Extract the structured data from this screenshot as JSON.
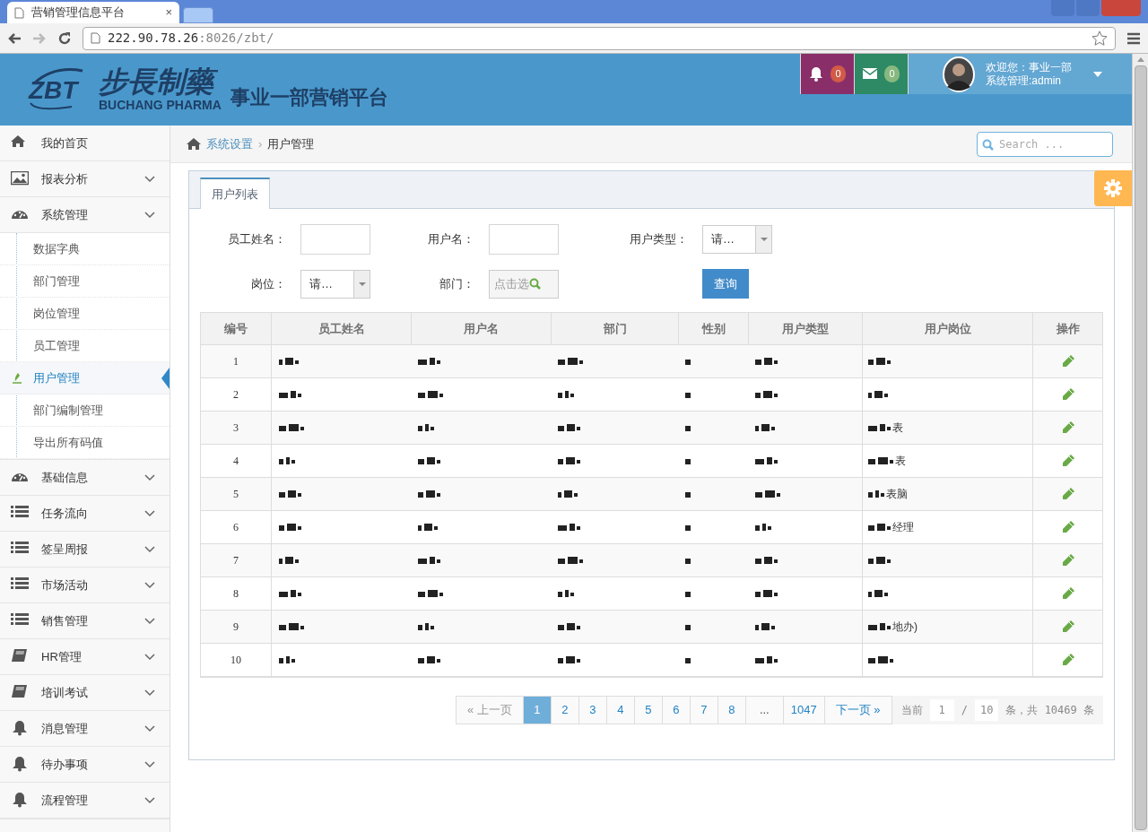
{
  "browser": {
    "tab_title": "营销管理信息平台",
    "tab_close": "×",
    "url_host": "222.90.78.26",
    "url_rest": ":8026/zbt/"
  },
  "header": {
    "logo_text": "ZBT",
    "brand_cn": "步長制藥",
    "brand_en": "BUCHANG PHARMA",
    "platform_title": "事业一部营销平台",
    "notifications": [
      {
        "kind": "bell",
        "count": "0"
      },
      {
        "kind": "mail",
        "count": "0"
      }
    ],
    "welcome": "欢迎您：事业一部",
    "role": "系统管理:admin"
  },
  "sidebar": {
    "items": [
      {
        "label": "我的首页",
        "kind": "home"
      },
      {
        "label": "报表分析",
        "kind": "picture"
      },
      {
        "label": "系统管理",
        "kind": "dashboard",
        "children": [
          {
            "label": "数据字典",
            "selected": false
          },
          {
            "label": "部门管理",
            "selected": false
          },
          {
            "label": "岗位管理",
            "selected": false
          },
          {
            "label": "员工管理",
            "selected": false
          },
          {
            "label": "用户管理",
            "selected": true
          },
          {
            "label": "部门编制管理",
            "selected": false
          },
          {
            "label": "导出所有码值",
            "selected": false
          }
        ]
      },
      {
        "label": "基础信息",
        "kind": "dashboard"
      },
      {
        "label": "任务流向",
        "kind": "list"
      },
      {
        "label": "签呈周报",
        "kind": "list"
      },
      {
        "label": "市场活动",
        "kind": "list"
      },
      {
        "label": "销售管理",
        "kind": "list"
      },
      {
        "label": "HR管理",
        "kind": "book"
      },
      {
        "label": "培训考试",
        "kind": "book"
      },
      {
        "label": "消息管理",
        "kind": "bell"
      },
      {
        "label": "待办事项",
        "kind": "bell"
      },
      {
        "label": "流程管理",
        "kind": "bell"
      }
    ]
  },
  "breadcrumb": [
    "系统设置",
    "用户管理"
  ],
  "breadcrumb_separator": "›",
  "search": {
    "placeholder": "Search ..."
  },
  "tabs": [
    {
      "label": "用户列表",
      "selected": true
    }
  ],
  "filters": [
    {
      "label": "员工姓名：",
      "kind": "text"
    },
    {
      "label": "用户名：",
      "kind": "text"
    },
    {
      "label": "用户类型：",
      "kind": "select",
      "value": "请…"
    },
    {
      "label": "岗位：",
      "kind": "select",
      "value": "请…"
    },
    {
      "label": "部门：",
      "kind": "picker",
      "placeholder": "点击选"
    }
  ],
  "query_button": "查询",
  "table": {
    "columns": [
      "编号",
      "员工姓名",
      "用户名",
      "部门",
      "性别",
      "用户类型",
      "用户岗位",
      "操作"
    ],
    "rows": [
      {
        "no": "1",
        "post_tail": ""
      },
      {
        "no": "2",
        "post_tail": ""
      },
      {
        "no": "3",
        "post_tail": "表"
      },
      {
        "no": "4",
        "post_tail": "表"
      },
      {
        "no": "5",
        "post_tail": "表脑"
      },
      {
        "no": "6",
        "post_tail": "经理"
      },
      {
        "no": "7",
        "post_tail": ""
      },
      {
        "no": "8",
        "post_tail": ""
      },
      {
        "no": "9",
        "post_tail": "地办)"
      },
      {
        "no": "10",
        "post_tail": ""
      }
    ]
  },
  "pagination": {
    "pages": [
      {
        "label": "« 上一页",
        "kind": "prev",
        "disabled": true
      },
      {
        "label": "1",
        "kind": "page",
        "selected": true
      },
      {
        "label": "2",
        "kind": "page",
        "selected": false
      },
      {
        "label": "3",
        "kind": "page",
        "selected": false
      },
      {
        "label": "4",
        "kind": "page",
        "selected": false
      },
      {
        "label": "5",
        "kind": "page",
        "selected": false
      },
      {
        "label": "6",
        "kind": "page",
        "selected": false
      },
      {
        "label": "7",
        "kind": "page",
        "selected": false
      },
      {
        "label": "8",
        "kind": "page",
        "selected": false
      },
      {
        "label": "...",
        "kind": "gap"
      },
      {
        "label": "1047",
        "kind": "page",
        "selected": false
      },
      {
        "label": "下一页 »",
        "kind": "next",
        "disabled": false
      }
    ],
    "current_label": "当前",
    "current_page": "1",
    "slash": "/",
    "page_size": "10",
    "total": "条，共 10469 条"
  }
}
